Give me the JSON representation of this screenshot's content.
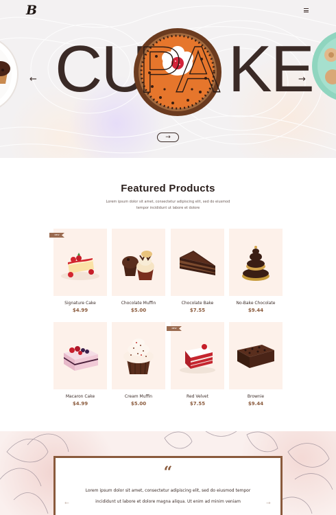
{
  "brand": {
    "logo_text": "B"
  },
  "header": {
    "menu_icon": "hamburger-menu-icon"
  },
  "hero": {
    "headline": "CUPCAKE",
    "headline_left": "CU",
    "headline_right": "KE",
    "headline_overlay": "PA",
    "prev_icon": "arrow-left-icon",
    "next_icon": "arrow-right-icon",
    "prev_glyph": "←",
    "next_glyph": "→",
    "cta_glyph": "→",
    "colors": {
      "text": "#3a2a26",
      "pie": "#e6762c",
      "crust": "#6b3b1f"
    }
  },
  "featured": {
    "title": "Featured Products",
    "subtitle": "Lorem ipsum dolor sit amet, consectetur adipiscing elit, sed do eiusmod tempor incididunt ut labore et dolore",
    "products": [
      {
        "name": "Signature Cake",
        "price": "$4.99",
        "tag": "NEW",
        "icon": "strawberry-cheesecake"
      },
      {
        "name": "Chocolate Muffin",
        "price": "$5.00",
        "tag": "",
        "icon": "chocolate-muffin"
      },
      {
        "name": "Chocolate Bake",
        "price": "$7.55",
        "tag": "",
        "icon": "chocolate-cake-slice"
      },
      {
        "name": "No-Bake Chocolate",
        "price": "$9.44",
        "tag": "",
        "icon": "chocolate-stack"
      },
      {
        "name": "Macaron Cake",
        "price": "$4.99",
        "tag": "",
        "icon": "berry-cake"
      },
      {
        "name": "Cream Muffin",
        "price": "$5.00",
        "tag": "",
        "icon": "cream-muffin"
      },
      {
        "name": "Red Velvet",
        "price": "$7.55",
        "tag": "NEW",
        "icon": "red-velvet-slice"
      },
      {
        "name": "Brownie",
        "price": "$9.44",
        "tag": "",
        "icon": "brownie"
      }
    ],
    "colors": {
      "card_bg": "#fdf1ea",
      "price": "#8a5a3c",
      "tag": "#9a6a4f"
    }
  },
  "testimonial": {
    "quote_mark": "“",
    "text": "Lorem ipsum dolor sit amet, consectetur adipiscing elit, sed do eiusmod tempor incididunt ut labore et dolore magna aliqua. Ut enim ad minim veniam",
    "prev_glyph": "←",
    "next_glyph": "→",
    "colors": {
      "border": "#8a5a3c"
    }
  }
}
